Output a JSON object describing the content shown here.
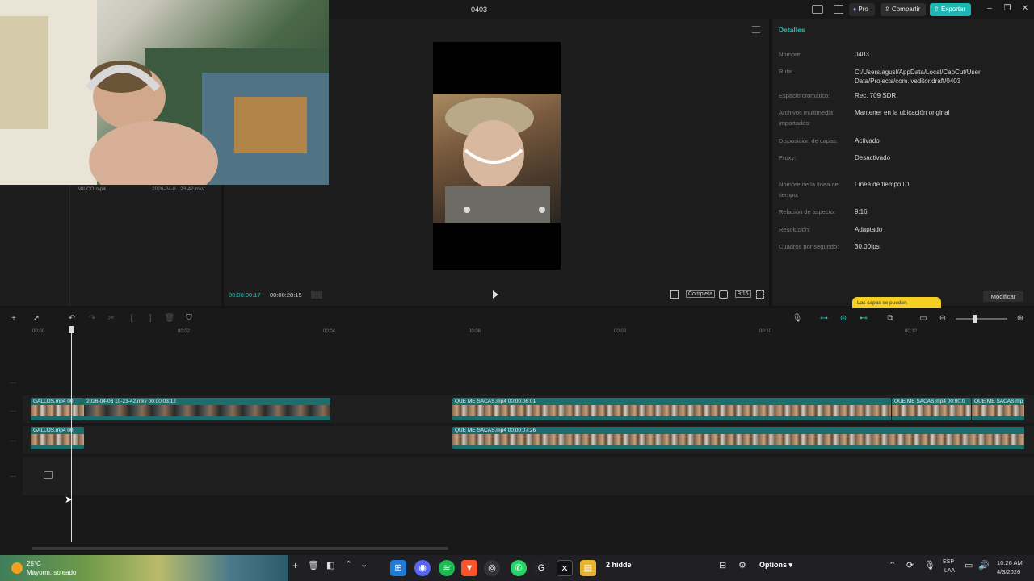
{
  "app": {
    "project_title": "0403",
    "pro_label": "Pro",
    "share_label": "Compartir",
    "export_label": "Exportar"
  },
  "media": {
    "item1": "MILCO.mp4",
    "item2": "2026-04-0...23-42.mkv"
  },
  "player": {
    "current_time": "00:00:00:17",
    "total_time": "00:00:28:15",
    "fit_label": "Completa",
    "ratio_label": "9:16"
  },
  "details": {
    "tab_title": "Detalles",
    "rows": [
      {
        "label": "Nombre:",
        "value": "0403"
      },
      {
        "label": "Ruta:",
        "value": "C:/Users/agusl/AppData/Local/CapCut/User Data/Projects/com.lveditor.draft/0403"
      },
      {
        "label": "Espacio cromático:",
        "value": "Rec. 709 SDR"
      },
      {
        "label": "Archivos multimedia importados:",
        "value": "Mantener en la ubicación original"
      },
      {
        "label": "Disposición de capas:",
        "value": "Activado"
      },
      {
        "label": "Proxy:",
        "value": "Desactivado"
      },
      {
        "label": "Nombre de la línea de tiempo:",
        "value": "Línea de tiempo 01"
      },
      {
        "label": "Relación de aspecto:",
        "value": "9:16"
      },
      {
        "label": "Resolución:",
        "value": "Adaptado"
      },
      {
        "label": "Cuadros por segundo:",
        "value": "30.00fps"
      }
    ],
    "modify_label": "Modificar",
    "toast": "Las capas se pueden"
  },
  "timeline": {
    "ruler": [
      "00:00",
      "00:02",
      "00:04",
      "00:06",
      "00:08",
      "00:10",
      "00:12"
    ],
    "clips": {
      "main_a": "GALLOS.mp4   00:",
      "main_b": "2026-04-03 10-23-42.mkv   00:00:03:12",
      "main_c": "QUE ME SACAS.mp4   00:00:06:01",
      "main_d": "QUE ME SACAS.mp4   00:00:0",
      "main_e": "QUE ME SACAS.mp",
      "over_a": "GALLOS.mp4   00:",
      "over_c": "QUE ME SACAS.mp4   00:00:07:26"
    }
  },
  "taskbar": {
    "temperature": "25°C",
    "weather": "Mayorm. soleado",
    "options_label": "Options",
    "lang1": "ESP",
    "lang2": "LAA",
    "time": "10:26 AM",
    "date": "4/3/2026",
    "hidden_app": "2 hidde"
  }
}
